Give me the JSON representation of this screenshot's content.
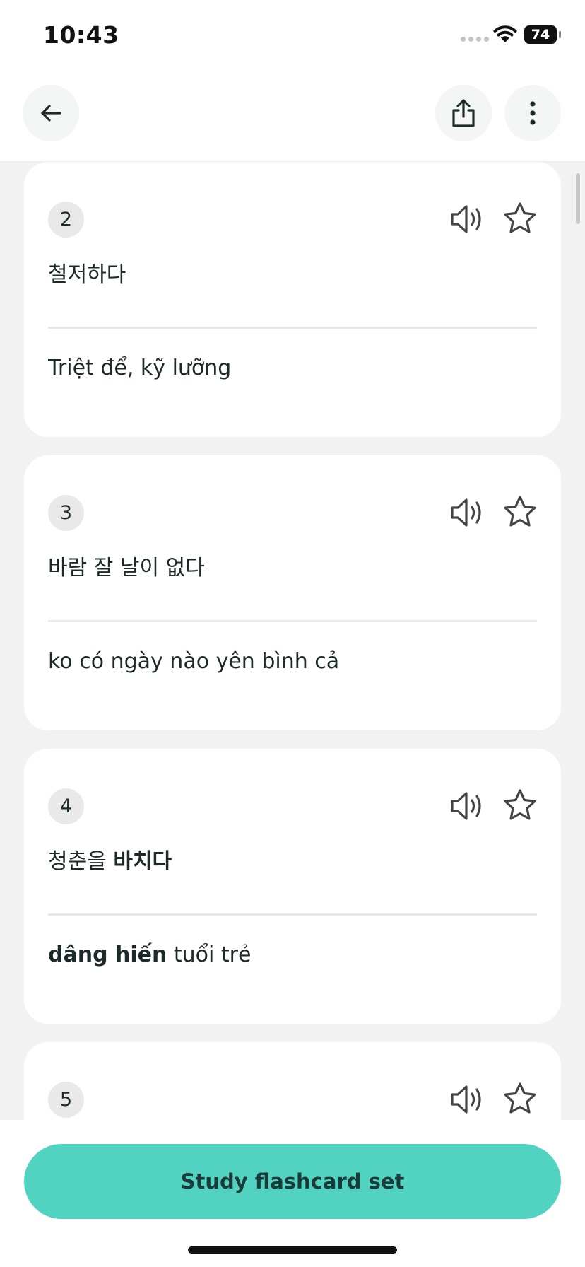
{
  "status_bar": {
    "time": "10:43",
    "battery": "74"
  },
  "header": {
    "back_icon": "arrow-left-icon",
    "share_icon": "share-icon",
    "more_icon": "more-vertical-icon"
  },
  "cards": [
    {
      "number": "2",
      "term": "철저하다",
      "definition": "Triệt để, kỹ lưỡng"
    },
    {
      "number": "3",
      "term": "바람 잘 날이 없다",
      "definition": "ko có ngày nào yên bình cả"
    },
    {
      "number": "4",
      "term_plain": "청춘을 ",
      "term_bold": "바치다",
      "definition_bold": "dâng hiến",
      "definition_plain": " tuổi trẻ"
    },
    {
      "number": "5"
    }
  ],
  "footer": {
    "study_button": "Study flashcard set"
  },
  "colors": {
    "accent": "#52d3c2",
    "text": "#1c2b29",
    "background": "#f2f2f2"
  }
}
